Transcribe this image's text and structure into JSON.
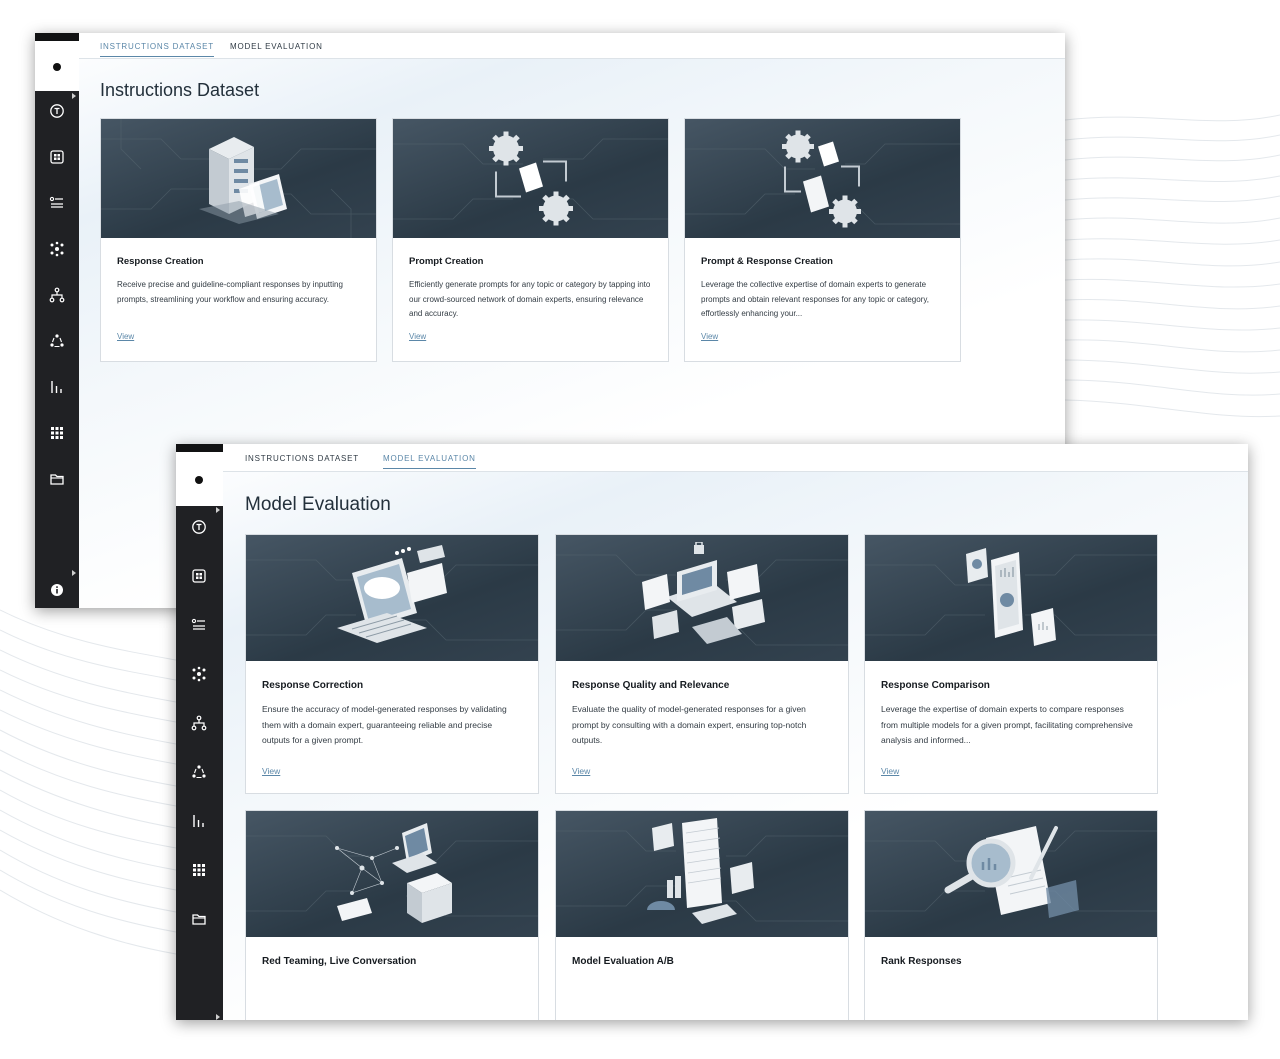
{
  "tabs": {
    "instructions_dataset": "INSTRUCTIONS DATASET",
    "model_evaluation": "MODEL EVALUATION"
  },
  "instructions": {
    "title": "Instructions Dataset",
    "active_tab": "instructions_dataset",
    "cards": [
      {
        "title": "Response Creation",
        "description": "Receive precise and guideline-compliant responses by inputting prompts, streamlining your workflow and ensuring accuracy.",
        "link": "View",
        "icon": "server-documents-illustration"
      },
      {
        "title": "Prompt Creation",
        "description": "Efficiently generate prompts for any topic or category by tapping into our crowd-sourced network of domain experts, ensuring relevance and accuracy.",
        "link": "View",
        "icon": "gears-document-illustration"
      },
      {
        "title": "Prompt & Response Creation",
        "description": "Leverage the collective expertise of domain experts to generate prompts and obtain relevant responses for any topic or category, effortlessly enhancing your...",
        "link": "View",
        "icon": "gears-documents-cycle-illustration"
      }
    ]
  },
  "evaluation": {
    "title": "Model Evaluation",
    "active_tab": "model_evaluation",
    "cards": [
      {
        "title": "Response Correction",
        "description": "Ensure the accuracy of model-generated responses by validating them with a domain expert, guaranteeing reliable and precise outputs for a given prompt.",
        "link": "View",
        "icon": "cloud-computer-illustration"
      },
      {
        "title": "Response Quality and Relevance",
        "description": "Evaluate the quality of model-generated responses for a given prompt by consulting with a domain expert, ensuring top-notch outputs.",
        "link": "View",
        "icon": "laptop-dashboard-illustration"
      },
      {
        "title": "Response Comparison",
        "description": "Leverage the expertise of domain experts to compare responses from multiple models for a given prompt, facilitating comprehensive analysis and informed...",
        "link": "View",
        "icon": "phone-comparison-illustration"
      },
      {
        "title": "Red Teaming, Live Conversation",
        "icon": "network-laptop-illustration"
      },
      {
        "title": "Model Evaluation A/B",
        "icon": "spreadsheet-charts-illustration"
      },
      {
        "title": "Rank Responses",
        "icon": "magnifier-report-illustration"
      }
    ]
  },
  "sidebar": {
    "icons": [
      "logo-dot",
      "t-circle-icon",
      "grid-box-icon",
      "list-icon",
      "cluster-icon",
      "hierarchy-icon",
      "cycle-icon",
      "bar-chart-icon",
      "apps-grid-icon",
      "folder-icon",
      "info-icon"
    ]
  },
  "colors": {
    "rail": "#202124",
    "accent": "#5b87a8",
    "card_image_bg": "#2f3e4a"
  }
}
